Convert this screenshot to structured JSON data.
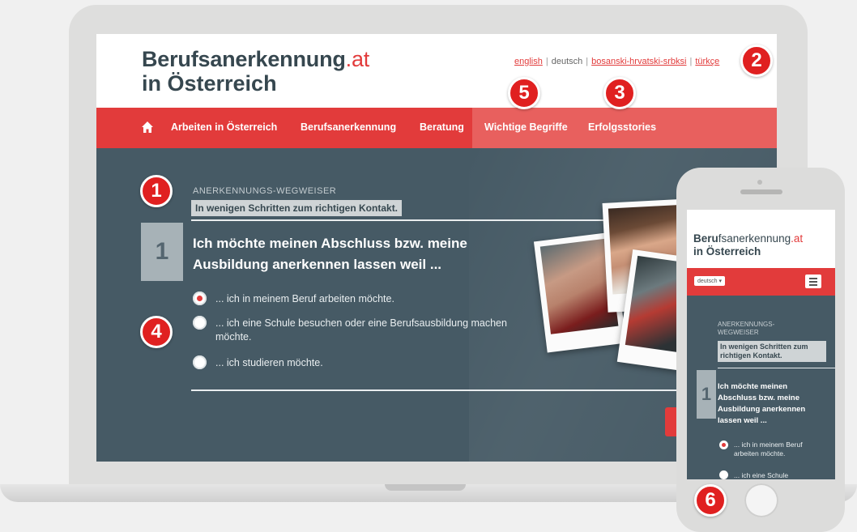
{
  "site": {
    "logo_name": "Berufsanerkennung",
    "logo_tld": ".at",
    "logo_sub": "in Österreich"
  },
  "languages": [
    "english",
    "deutsch",
    "bosanski-hrvatski-srbksi",
    "türkçe"
  ],
  "nav": {
    "home_icon": "home-icon",
    "items": [
      "Arbeiten in Österreich",
      "Berufsanerkennung",
      "Beratung",
      "Wichtige Begriffe",
      "Erfolgsstories"
    ]
  },
  "wizard": {
    "label": "ANERKENNUNGS-WEGWEISER",
    "tagline": "In wenigen Schritten zum richtigen Kontakt.",
    "step": "1",
    "question": "Ich möchte meinen Abschluss bzw. meine Ausbildung anerkennen lassen weil ...",
    "options": [
      {
        "label": "... ich in meinem Beruf arbeiten möchte.",
        "selected": true
      },
      {
        "label": "... ich eine Schule besuchen oder eine Berufsausbildung machen möchte.",
        "selected": false
      },
      {
        "label": "... ich studieren möchte.",
        "selected": false
      }
    ]
  },
  "mobile": {
    "logo_name_bold": "Beru",
    "logo_name_rest": "fsanerkennung",
    "logo_tld": ".at",
    "logo_sub": "in Österreich",
    "lang_select": "deutsch",
    "label": "ANERKENNUNGS-WEGWEISER",
    "tagline": "In wenigen Schritten zum richtigen Kontakt.",
    "step": "1",
    "question": "Ich möchte meinen Abschluss bzw. meine Ausbildung anerkennen lassen weil ...",
    "option1": "... ich in meinem Beruf arbeiten möchte.",
    "option2": "... ich eine Schule"
  },
  "callouts": [
    "1",
    "2",
    "3",
    "4",
    "5",
    "6"
  ],
  "colors": {
    "accent": "#e23b3b",
    "dark": "#36474f",
    "panel": "#465a65",
    "badge": "#e02020"
  }
}
